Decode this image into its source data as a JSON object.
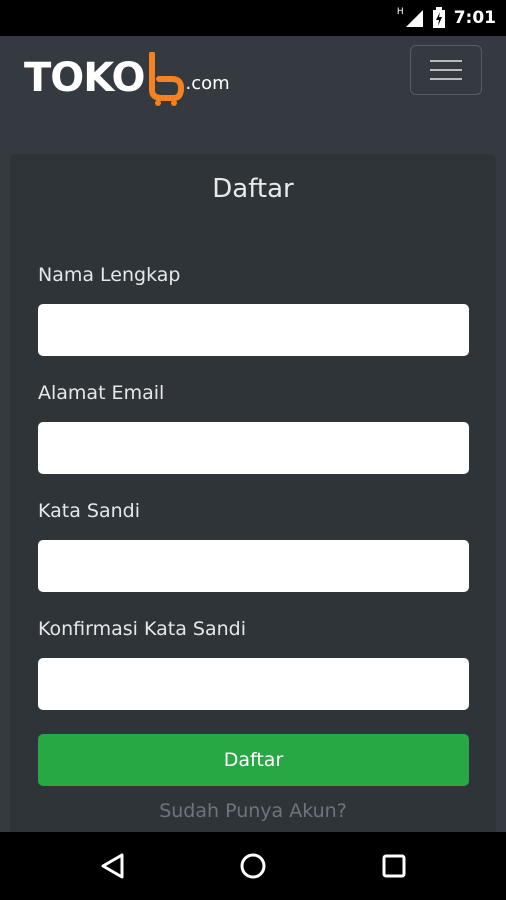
{
  "status_bar": {
    "time": "7:01",
    "network_indicator": "H",
    "icons": [
      "signal-icon",
      "battery-charging-icon"
    ]
  },
  "header": {
    "logo_text": "TOKO",
    "logo_tld": ".com",
    "logo_accent_color": "#f58220",
    "menu_icon": "hamburger-menu-icon"
  },
  "form": {
    "title": "Daftar",
    "fields": [
      {
        "label": "Nama Lengkap",
        "value": "",
        "placeholder": ""
      },
      {
        "label": "Alamat Email",
        "value": "",
        "placeholder": ""
      },
      {
        "label": "Kata Sandi",
        "value": "",
        "placeholder": ""
      },
      {
        "label": "Konfirmasi Kata Sandi",
        "value": "",
        "placeholder": ""
      }
    ],
    "submit_label": "Daftar",
    "submit_color": "#28a745",
    "login_link": "Sudah Punya Akun?"
  },
  "nav_bar": {
    "buttons": [
      "back-icon",
      "home-icon",
      "recents-icon"
    ]
  },
  "colors": {
    "background": "#343a40",
    "card": "#2f3439"
  }
}
